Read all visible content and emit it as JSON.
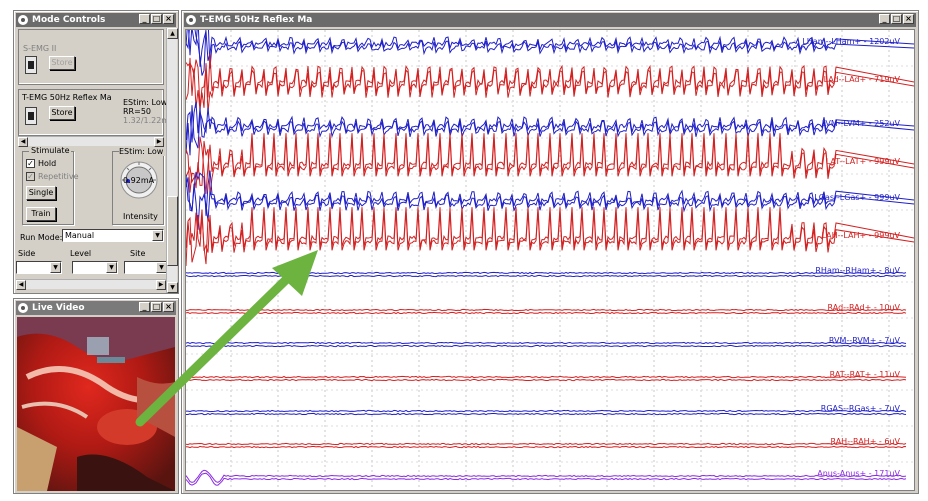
{
  "mode_controls": {
    "title": "Mode Controls",
    "semg_label": "S-EMG II",
    "semg_store": "Store",
    "temg_label": "T-EMG 50Hz Reflex Ma",
    "temg_store": "Store",
    "estim_line1": "EStim: Low 1",
    "estim_line2": "RR=50",
    "estim_line3": "1.32/1.22mA",
    "stimulate": {
      "title": "Stimulate",
      "hold": "Hold",
      "repetitive": "Repetitive",
      "single": "Single",
      "train": "Train"
    },
    "estim_knob_title": "EStim: Low 1",
    "knob_value": "0.92mA",
    "intensity": "Intensity",
    "run_mode_label": "Run Mode:",
    "run_mode_value": "Manual",
    "side_label": "Side",
    "level_label": "Level",
    "site_label": "Site"
  },
  "live_video": {
    "title": "Live Video"
  },
  "emg_window": {
    "title": "T-EMG 50Hz Reflex Ma",
    "channels": [
      {
        "label": "LHam--LHam+ - 1202uV",
        "color": "#1f1fc8"
      },
      {
        "label": "LAd--LAd+ - 719uV",
        "color": "#d42020"
      },
      {
        "label": "LVM--LVM+ - 252uV",
        "color": "#1f1fc8"
      },
      {
        "label": "LAT--LAT+ - 999uV",
        "color": "#d42020"
      },
      {
        "label": "LGas--LGas+ - 999uV",
        "color": "#1f1fc8"
      },
      {
        "label": "LAH--LAH+ - 999uV",
        "color": "#d42020"
      },
      {
        "label": "RHam--RHam+ - 8uV",
        "color": "#1f1fc8"
      },
      {
        "label": "RAd--RAd+ - 10uV",
        "color": "#d42020"
      },
      {
        "label": "RVM--RVM+ - 7uV",
        "color": "#1f1fc8"
      },
      {
        "label": "RAT--RAT+ - 11uV",
        "color": "#d42020"
      },
      {
        "label": "RGAS--RGas+ - 7uV",
        "color": "#1f1fc8"
      },
      {
        "label": "RAH--RAH+ - 6uV",
        "color": "#d42020"
      },
      {
        "label": "Anus-Anus+ - 171uV",
        "color": "#8a2be2"
      }
    ]
  },
  "colors": {
    "arrow": "#6cb33f",
    "blue_trace": "#1f1fc8",
    "red_trace": "#d42020",
    "purple_trace": "#8a2be2"
  }
}
